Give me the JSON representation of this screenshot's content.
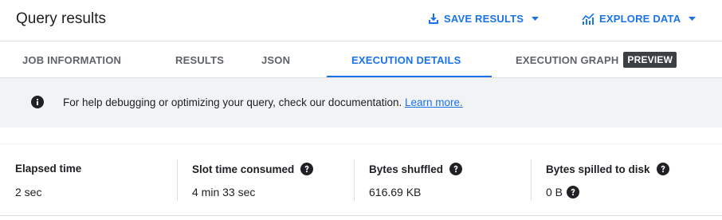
{
  "header": {
    "title": "Query results",
    "save_results_label": "SAVE RESULTS",
    "explore_data_label": "EXPLORE DATA"
  },
  "tabs": [
    {
      "label": "JOB INFORMATION",
      "active": false
    },
    {
      "label": "RESULTS",
      "active": false
    },
    {
      "label": "JSON",
      "active": false
    },
    {
      "label": "EXECUTION DETAILS",
      "active": true
    },
    {
      "label": "EXECUTION GRAPH",
      "active": false,
      "badge": "PREVIEW"
    }
  ],
  "banner": {
    "message": "For help debugging or optimizing your query, check our documentation.",
    "link_text": "Learn more."
  },
  "stats": [
    {
      "label": "Elapsed time",
      "value": "2 sec"
    },
    {
      "label": "Slot time consumed",
      "value": "4 min 33 sec"
    },
    {
      "label": "Bytes shuffled",
      "value": "616.69 KB"
    },
    {
      "label": "Bytes spilled to disk",
      "value": "0 B"
    }
  ],
  "colors": {
    "accent": "#1a73e8",
    "text": "#202124",
    "muted_tab": "#5f6368",
    "banner_bg": "#f1f3f4",
    "badge_bg": "#3c4043"
  },
  "icons": {
    "save": "download-icon",
    "explore": "chart-icon",
    "caret": "caret-down-icon",
    "info": "info-icon",
    "help": "help-icon"
  }
}
